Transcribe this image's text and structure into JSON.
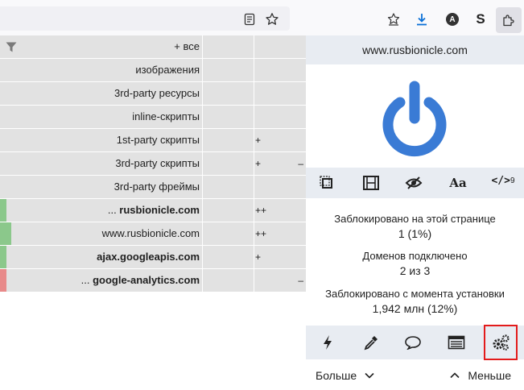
{
  "browser": {
    "icons": [
      "reader-view-icon",
      "bookmark-star-icon",
      "pocket-save-icon",
      "download-icon",
      "account-a-icon",
      "extension-s-icon",
      "extensions-puzzle-icon"
    ],
    "account_letter": "A",
    "ext_letter": "S"
  },
  "matrix": {
    "rows": [
      {
        "name": "+ все",
        "bold": false,
        "col2_left": "",
        "col2_right": "",
        "bar": ""
      },
      {
        "name": "изображения",
        "bold": false,
        "col2_left": "",
        "col2_right": "",
        "bar": ""
      },
      {
        "name": "3rd-party ресурсы",
        "bold": false,
        "col2_left": "",
        "col2_right": "",
        "bar": ""
      },
      {
        "name": "inline-скрипты",
        "bold": false,
        "col2_left": "",
        "col2_right": "",
        "bar": ""
      },
      {
        "name": "1st-party скрипты",
        "bold": false,
        "col2_left": "+",
        "col2_right": "",
        "bar": ""
      },
      {
        "name": "3rd-party скрипты",
        "bold": false,
        "col2_left": "+",
        "col2_right": "–",
        "bar": ""
      },
      {
        "name": "3rd-party фреймы",
        "bold": false,
        "col2_left": "",
        "col2_right": "",
        "bar": ""
      },
      {
        "name_prefix": "... ",
        "name": "rusbionicle.com",
        "bold": true,
        "col2_left": "++",
        "col2_right": "",
        "bar": "green"
      },
      {
        "name": "www.rusbionicle.com",
        "bold": false,
        "col2_left": "++",
        "col2_right": "",
        "bar": "green-wide"
      },
      {
        "name": "ajax.googleapis.com",
        "bold": true,
        "col2_left": "+",
        "col2_right": "",
        "bar": "green"
      },
      {
        "name_prefix": "... ",
        "name": "google-analytics.com",
        "bold": true,
        "col2_left": "",
        "col2_right": "–",
        "bar": "red"
      }
    ]
  },
  "panel": {
    "hostname": "www.rusbionicle.com",
    "power_on": true,
    "tools": {
      "zapper_icon": "element-zapper-icon",
      "media_icon": "film-media-icon",
      "cosmetic_icon": "eye-slash-icon",
      "fonts_label": "Aa",
      "scripts_label": "</>",
      "scripts_count": "9"
    },
    "stats": {
      "blocked_page_label": "Заблокировано на этой странице",
      "blocked_page_value": "1 (1%)",
      "domains_label": "Доменов подключено",
      "domains_value": "2 из 3",
      "blocked_total_label": "Заблокировано с момента установки",
      "blocked_total_value": "1,942 млн (12%)"
    },
    "actions": [
      "lightning-icon",
      "eyedropper-icon",
      "speech-bubble-icon",
      "logger-list-icon",
      "gears-icon"
    ],
    "more_label": "Больше",
    "less_label": "Меньше"
  },
  "colors": {
    "accent_blue": "#3a7bd5",
    "cell_gray": "#e2e2e2",
    "panel_bg": "#e8ecf2",
    "allowed_green": "#8bc88b",
    "blocked_red": "#e88a8a",
    "highlight_red": "#e31b1b"
  }
}
